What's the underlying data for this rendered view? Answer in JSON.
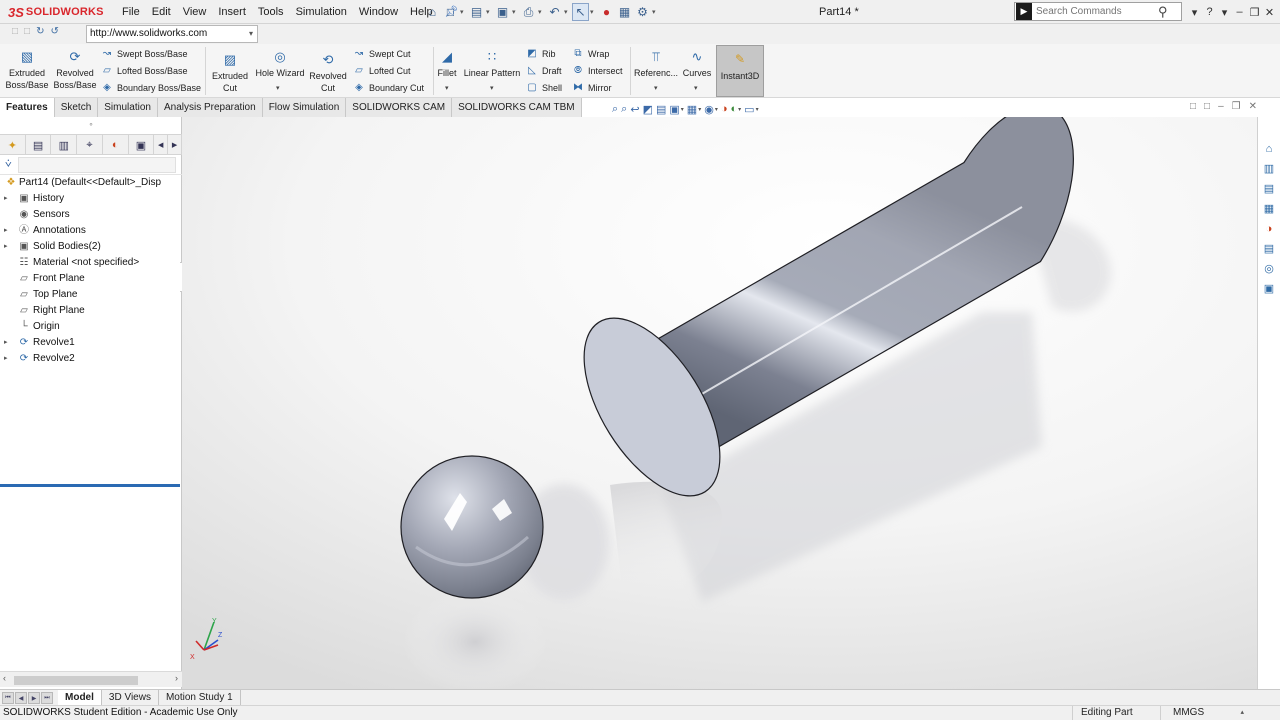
{
  "app": {
    "logo_ds": "3S",
    "logo_text": "SOLIDWORKS",
    "document_title": "Part14 *"
  },
  "menu": [
    "File",
    "Edit",
    "View",
    "Insert",
    "Tools",
    "Simulation",
    "Window",
    "Help"
  ],
  "search": {
    "placeholder": "Search Commands"
  },
  "url": {
    "value": "http://www.solidworks.com"
  },
  "ribbon": {
    "extruded_boss": "Extruded Boss/Base",
    "revolved_boss": "Revolved Boss/Base",
    "swept_boss": "Swept Boss/Base",
    "lofted_boss": "Lofted Boss/Base",
    "boundary_boss": "Boundary Boss/Base",
    "extruded_cut": "Extruded Cut",
    "hole_wizard": "Hole Wizard",
    "revolved_cut": "Revolved Cut",
    "swept_cut": "Swept Cut",
    "lofted_cut": "Lofted Cut",
    "boundary_cut": "Boundary Cut",
    "fillet": "Fillet",
    "linear_pattern": "Linear Pattern",
    "rib": "Rib",
    "draft": "Draft",
    "shell": "Shell",
    "wrap": "Wrap",
    "intersect": "Intersect",
    "mirror": "Mirror",
    "reference": "Referenc...",
    "curves": "Curves",
    "instant3d": "Instant3D"
  },
  "command_tabs": [
    {
      "label": "Features",
      "active": true
    },
    {
      "label": "Sketch",
      "active": false
    },
    {
      "label": "Simulation",
      "active": false
    },
    {
      "label": "Analysis Preparation",
      "active": false
    },
    {
      "label": "Flow Simulation",
      "active": false
    },
    {
      "label": "SOLIDWORKS CAM",
      "active": false
    },
    {
      "label": "SOLIDWORKS CAM TBM",
      "active": false
    }
  ],
  "tree": {
    "root": "Part14  (Default<<Default>_Disp",
    "items": [
      {
        "label": "History",
        "icon": "history-icon",
        "expandable": true
      },
      {
        "label": "Sensors",
        "icon": "sensor-icon",
        "expandable": false
      },
      {
        "label": "Annotations",
        "icon": "annotation-icon",
        "expandable": true
      },
      {
        "label": "Solid Bodies(2)",
        "icon": "solid-bodies-icon",
        "expandable": true
      },
      {
        "label": "Material <not specified>",
        "icon": "material-icon",
        "expandable": false
      },
      {
        "label": "Front Plane",
        "icon": "plane-icon",
        "expandable": false
      },
      {
        "label": "Top Plane",
        "icon": "plane-icon",
        "expandable": false
      },
      {
        "label": "Right Plane",
        "icon": "plane-icon",
        "expandable": false
      },
      {
        "label": "Origin",
        "icon": "origin-icon",
        "expandable": false
      },
      {
        "label": "Revolve1",
        "icon": "revolve-icon",
        "expandable": true
      },
      {
        "label": "Revolve2",
        "icon": "revolve-icon",
        "expandable": true
      }
    ]
  },
  "triad": {
    "x": "X",
    "y": "Y",
    "z": "Z"
  },
  "bottom_tabs": [
    {
      "label": "Model",
      "active": true
    },
    {
      "label": "3D Views",
      "active": false
    },
    {
      "label": "Motion Study 1",
      "active": false
    }
  ],
  "status": {
    "left": "SOLIDWORKS Student Edition - Academic Use Only",
    "editing": "Editing Part",
    "units": "MMGS"
  },
  "colors": {
    "brand_red": "#d9262c",
    "accent_blue": "#2a6ab3",
    "model_steel": "#8f939f"
  }
}
